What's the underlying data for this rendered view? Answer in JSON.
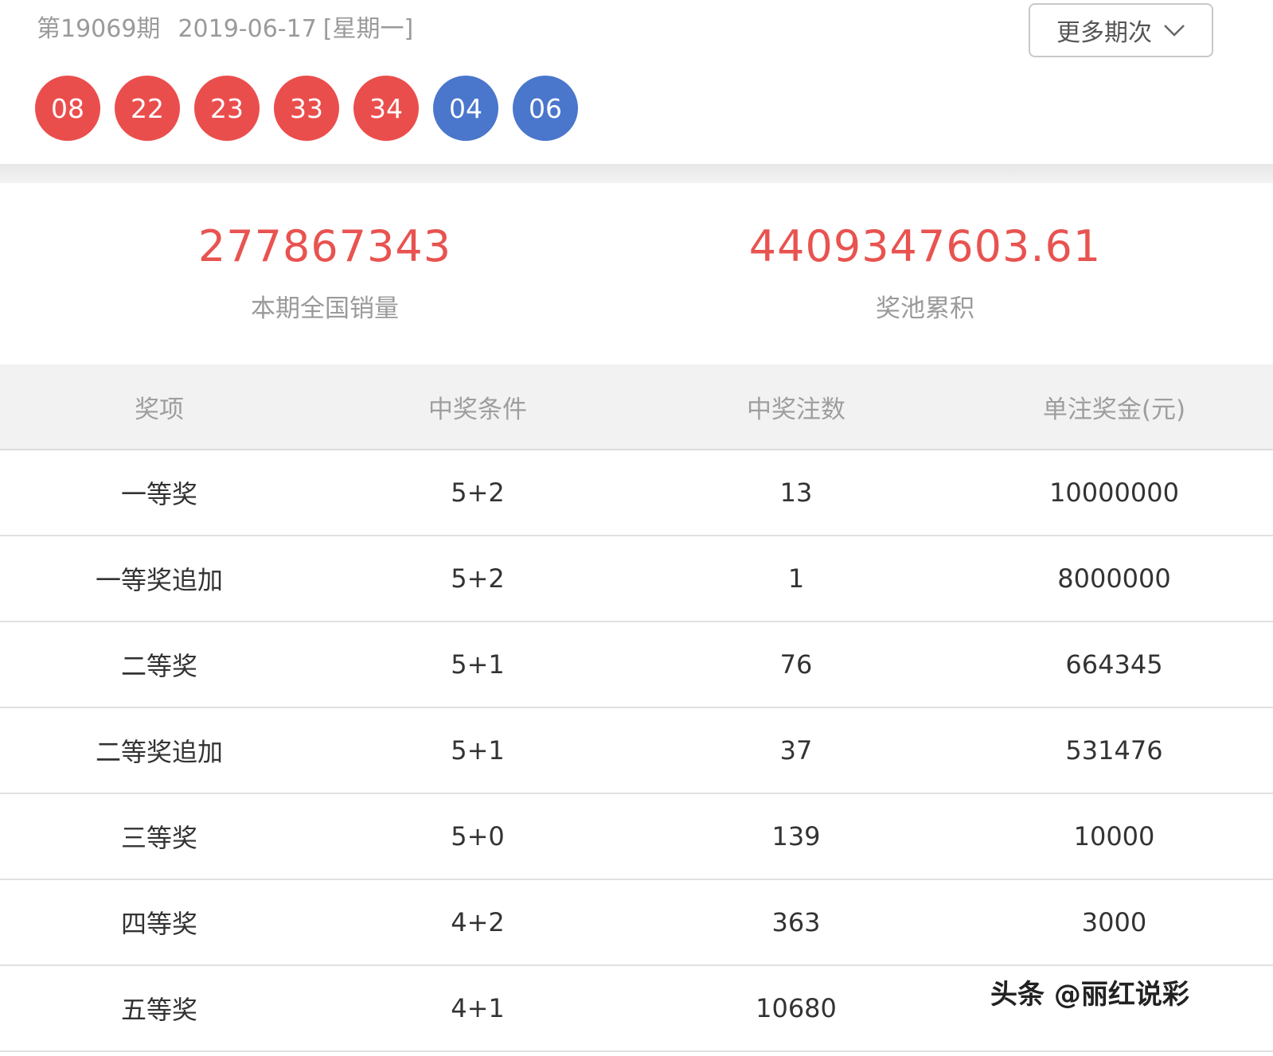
{
  "header": {
    "issue": "第19069期",
    "date": "2019-06-17",
    "weekday": "[星期一]",
    "more_button": "更多期次"
  },
  "balls": {
    "red": [
      "08",
      "22",
      "23",
      "33",
      "34"
    ],
    "blue": [
      "04",
      "06"
    ],
    "red_color": "#ea4e4c",
    "blue_color": "#4a76cc"
  },
  "stats": {
    "sales_value": "277867343",
    "sales_label": "本期全国销量",
    "pool_value": "4409347603.61",
    "pool_label": "奖池累积"
  },
  "table": {
    "headers": [
      "奖项",
      "中奖条件",
      "中奖注数",
      "单注奖金(元)"
    ],
    "rows": [
      [
        "一等奖",
        "5+2",
        "13",
        "10000000"
      ],
      [
        "一等奖追加",
        "5+2",
        "1",
        "8000000"
      ],
      [
        "二等奖",
        "5+1",
        "76",
        "664345"
      ],
      [
        "二等奖追加",
        "5+1",
        "37",
        "531476"
      ],
      [
        "三等奖",
        "5+0",
        "139",
        "10000"
      ],
      [
        "四等奖",
        "4+2",
        "363",
        "3000"
      ],
      [
        "五等奖",
        "4+1",
        "10680",
        ""
      ]
    ]
  },
  "watermark": "头条 @丽红说彩"
}
